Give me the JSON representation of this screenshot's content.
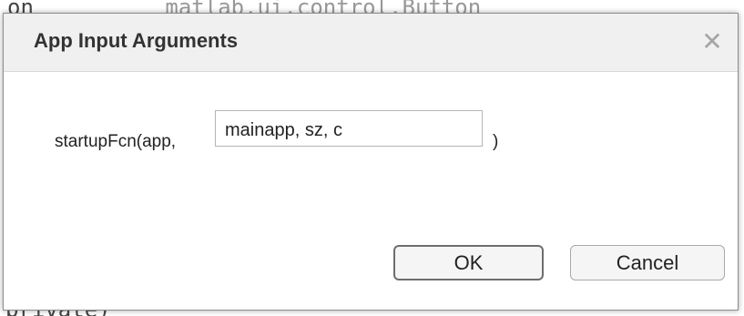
{
  "background_code": {
    "top_line_prefix": "on",
    "top_line_text": "matlab.ui.control.Button",
    "bottom_line_text": "private)"
  },
  "dialog": {
    "title": "App Input Arguments",
    "close_icon": "close-icon",
    "close_glyph": "✕",
    "function_prefix": "startupFcn(app,",
    "input_value": "mainapp, sz, c",
    "function_suffix": ")",
    "ok_label": "OK",
    "cancel_label": "Cancel"
  },
  "colors": {
    "titlebar_bg": "#f0f0f0",
    "title_text": "#333333",
    "close_icon": "#a6a6a6",
    "ok_border": "#6e6e6e",
    "button_bg": "#f5f5f5"
  }
}
